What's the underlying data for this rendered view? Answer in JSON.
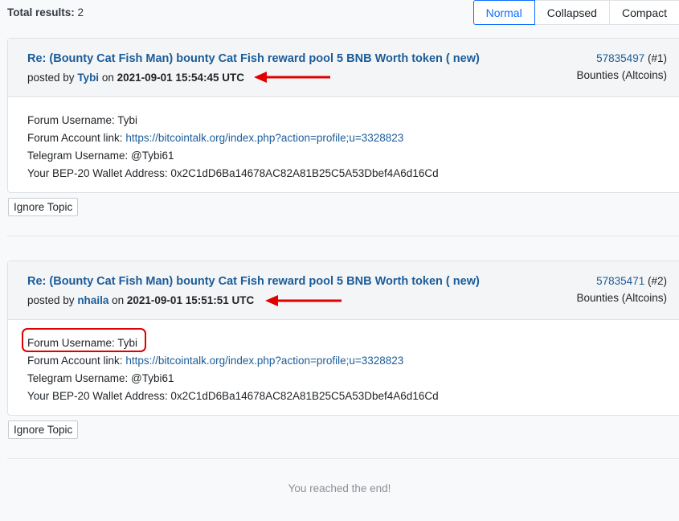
{
  "results": {
    "label": "Total results:",
    "count": "2"
  },
  "view_modes": [
    "Normal",
    "Collapsed",
    "Compact"
  ],
  "posts": [
    {
      "title": "Re: (Bounty Cat Fish Man) bounty Cat Fish reward pool 5 BNB Worth token ( new)",
      "posted_by": "posted by",
      "user": "Tybi",
      "on": "on",
      "date": "2021-09-01 15:54:45 UTC",
      "msg_id": "57835497",
      "index": "(#1)",
      "category": "Bounties (Altcoins)",
      "lines": [
        {
          "label": "Forum Username: Tybi"
        },
        {
          "label": "Forum Account link: ",
          "link": "https://bitcointalk.org/index.php?action=profile;u=3328823"
        },
        {
          "label": "Telegram Username: @Tybi61"
        },
        {
          "label": "Your BEP-20 Wallet Address: 0x2C1dD6Ba14678AC82A81B25C5A53Dbef4A6d16Cd"
        }
      ],
      "ignore_label": "Ignore Topic"
    },
    {
      "title": "Re: (Bounty Cat Fish Man) bounty Cat Fish reward pool 5 BNB Worth token ( new)",
      "posted_by": "posted by",
      "user": "nhaila",
      "on": "on",
      "date": "2021-09-01 15:51:51 UTC",
      "msg_id": "57835471",
      "index": "(#2)",
      "category": "Bounties (Altcoins)",
      "lines": [
        {
          "label": "Forum Username: Tybi"
        },
        {
          "label": "Forum Account link: ",
          "link": "https://bitcointalk.org/index.php?action=profile;u=3328823"
        },
        {
          "label": "Telegram Username: @Tybi61"
        },
        {
          "label": "Your BEP-20 Wallet Address: 0x2C1dD6Ba14678AC82A81B25C5A53Dbef4A6d16Cd"
        }
      ],
      "ignore_label": "Ignore Topic"
    }
  ],
  "end_message": "You reached the end!",
  "colors": {
    "link": "#1b5c9a",
    "accent": "#0d6efd",
    "annotation": "#e00000"
  },
  "icons": {
    "annotation_arrow": "left-arrow-icon"
  }
}
